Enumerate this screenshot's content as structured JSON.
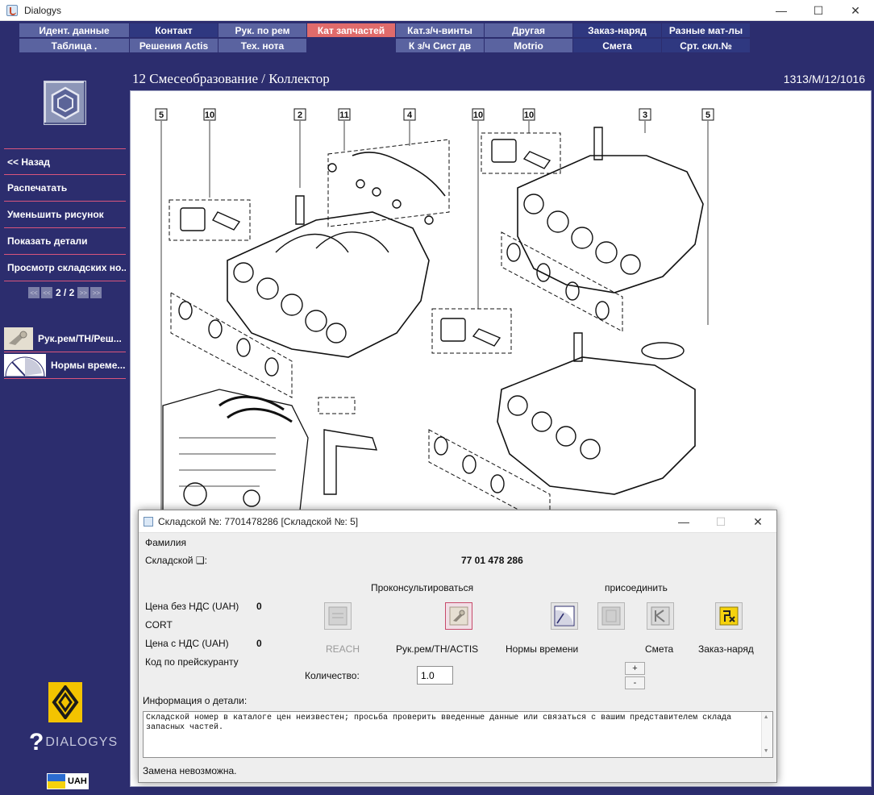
{
  "window": {
    "title": "Dialogys",
    "controls": {
      "minimize": "—",
      "maximize": "☐",
      "close": "✕"
    }
  },
  "nav": {
    "row1": [
      {
        "label": "Идент. данные",
        "style": "blue"
      },
      {
        "label": "Контакт",
        "style": "dark"
      },
      {
        "label": "Рук. по рем",
        "style": "blue"
      },
      {
        "label": "Кат запчастей",
        "style": "red"
      },
      {
        "label": "Кат.з/ч-винты",
        "style": "blue"
      },
      {
        "label": "Другая",
        "style": "blue"
      },
      {
        "label": "Заказ-наряд",
        "style": "dark"
      },
      {
        "label": "Разные мат-лы",
        "style": "dark"
      }
    ],
    "row2": [
      {
        "label": "Таблица .",
        "style": "blue"
      },
      {
        "label": "Решения Actis",
        "style": "blue"
      },
      {
        "label": "Тех. нота",
        "style": "blue"
      },
      {
        "label": "",
        "style": "empty"
      },
      {
        "label": "К з/ч Сист дв",
        "style": "blue"
      },
      {
        "label": "Motrio",
        "style": "blue"
      },
      {
        "label": "Смета",
        "style": "dark"
      },
      {
        "label": "Срт. скл.№",
        "style": "dark"
      }
    ]
  },
  "header": {
    "section_title": "12 Смесеобразование / Коллектор",
    "ref_code": "1313/M/12/1016"
  },
  "sidebar": {
    "menu": [
      {
        "name": "back",
        "label": "<< Назад"
      },
      {
        "name": "print",
        "label": "Распечатать"
      },
      {
        "name": "zoom-out",
        "label": "Уменьшить рисунок"
      },
      {
        "name": "show-details",
        "label": "Показать детали"
      },
      {
        "name": "stock-numbers",
        "label": "Просмотр складских но..."
      }
    ],
    "pager": {
      "first": "<<",
      "prev": "<<",
      "text": "2 / 2",
      "next": ">>",
      "last": ">>"
    },
    "links": [
      {
        "name": "manual-link",
        "label": "Рук.рем/ТН/Реш..."
      },
      {
        "name": "time-norms-link",
        "label": "Нормы време..."
      }
    ],
    "brand_text": "DIALOGYS",
    "brand_q": "?",
    "currency": "UAH"
  },
  "diagram": {
    "callouts": [
      "5",
      "10",
      "2",
      "11",
      "4",
      "10",
      "10",
      "3",
      "5"
    ]
  },
  "dialog": {
    "title": "Складской №: 7701478286 [Складской №: 5]",
    "surname_label": "Фамилия",
    "stock_label": "Складской ❑:",
    "stock_value": "77 01 478 286",
    "consult_label": "Проконсультироваться",
    "attach_label": "присоединить",
    "price_no_vat_label": "Цена без НДС (UAH)",
    "price_no_vat_value": "0",
    "cort_label": "CORT",
    "price_vat_label": "Цена с НДС (UAH)",
    "price_vat_value": "0",
    "pricelist_code_label": "Код по прейскуранту",
    "reach_label": "REACH",
    "manual_label": "Рук.рем/ТН/ACTIS",
    "time_norms_label": "Нормы времени",
    "estimate_label": "Смета",
    "work_order_label": "Заказ-наряд",
    "quantity_label": "Количество:",
    "quantity_value": "1.0",
    "plus": "+",
    "minus": "-",
    "info_label": "Информация о детали:",
    "info_text": "Складской номер в каталоге цен неизвестен; просьба проверить введенные данные или связаться с вашим представителем склада запасных частей.",
    "status_text": "Замена невозможна."
  }
}
